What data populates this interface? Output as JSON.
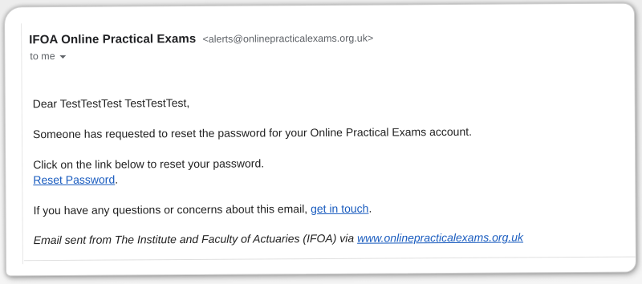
{
  "email": {
    "sender_name": "IFOA Online Practical Exams",
    "sender_email": "<alerts@onlinepracticalexams.org.uk>",
    "recipient_label": "to me",
    "greeting": "Dear TestTestTest TestTestTest,",
    "line_request": "Someone has requested to reset the password for your Online Practical Exams account.",
    "line_click": "Click on the link below to reset your password.",
    "reset_link": "Reset Password",
    "reset_suffix": ".",
    "questions_prefix": "If you have any questions or concerns about this email, ",
    "contact_link": "get in touch",
    "questions_suffix": ".",
    "footer_prefix": "Email sent from The Institute and Faculty of Actuaries (IFOA) via ",
    "footer_link": "www.onlinepracticalexams.org.uk"
  }
}
